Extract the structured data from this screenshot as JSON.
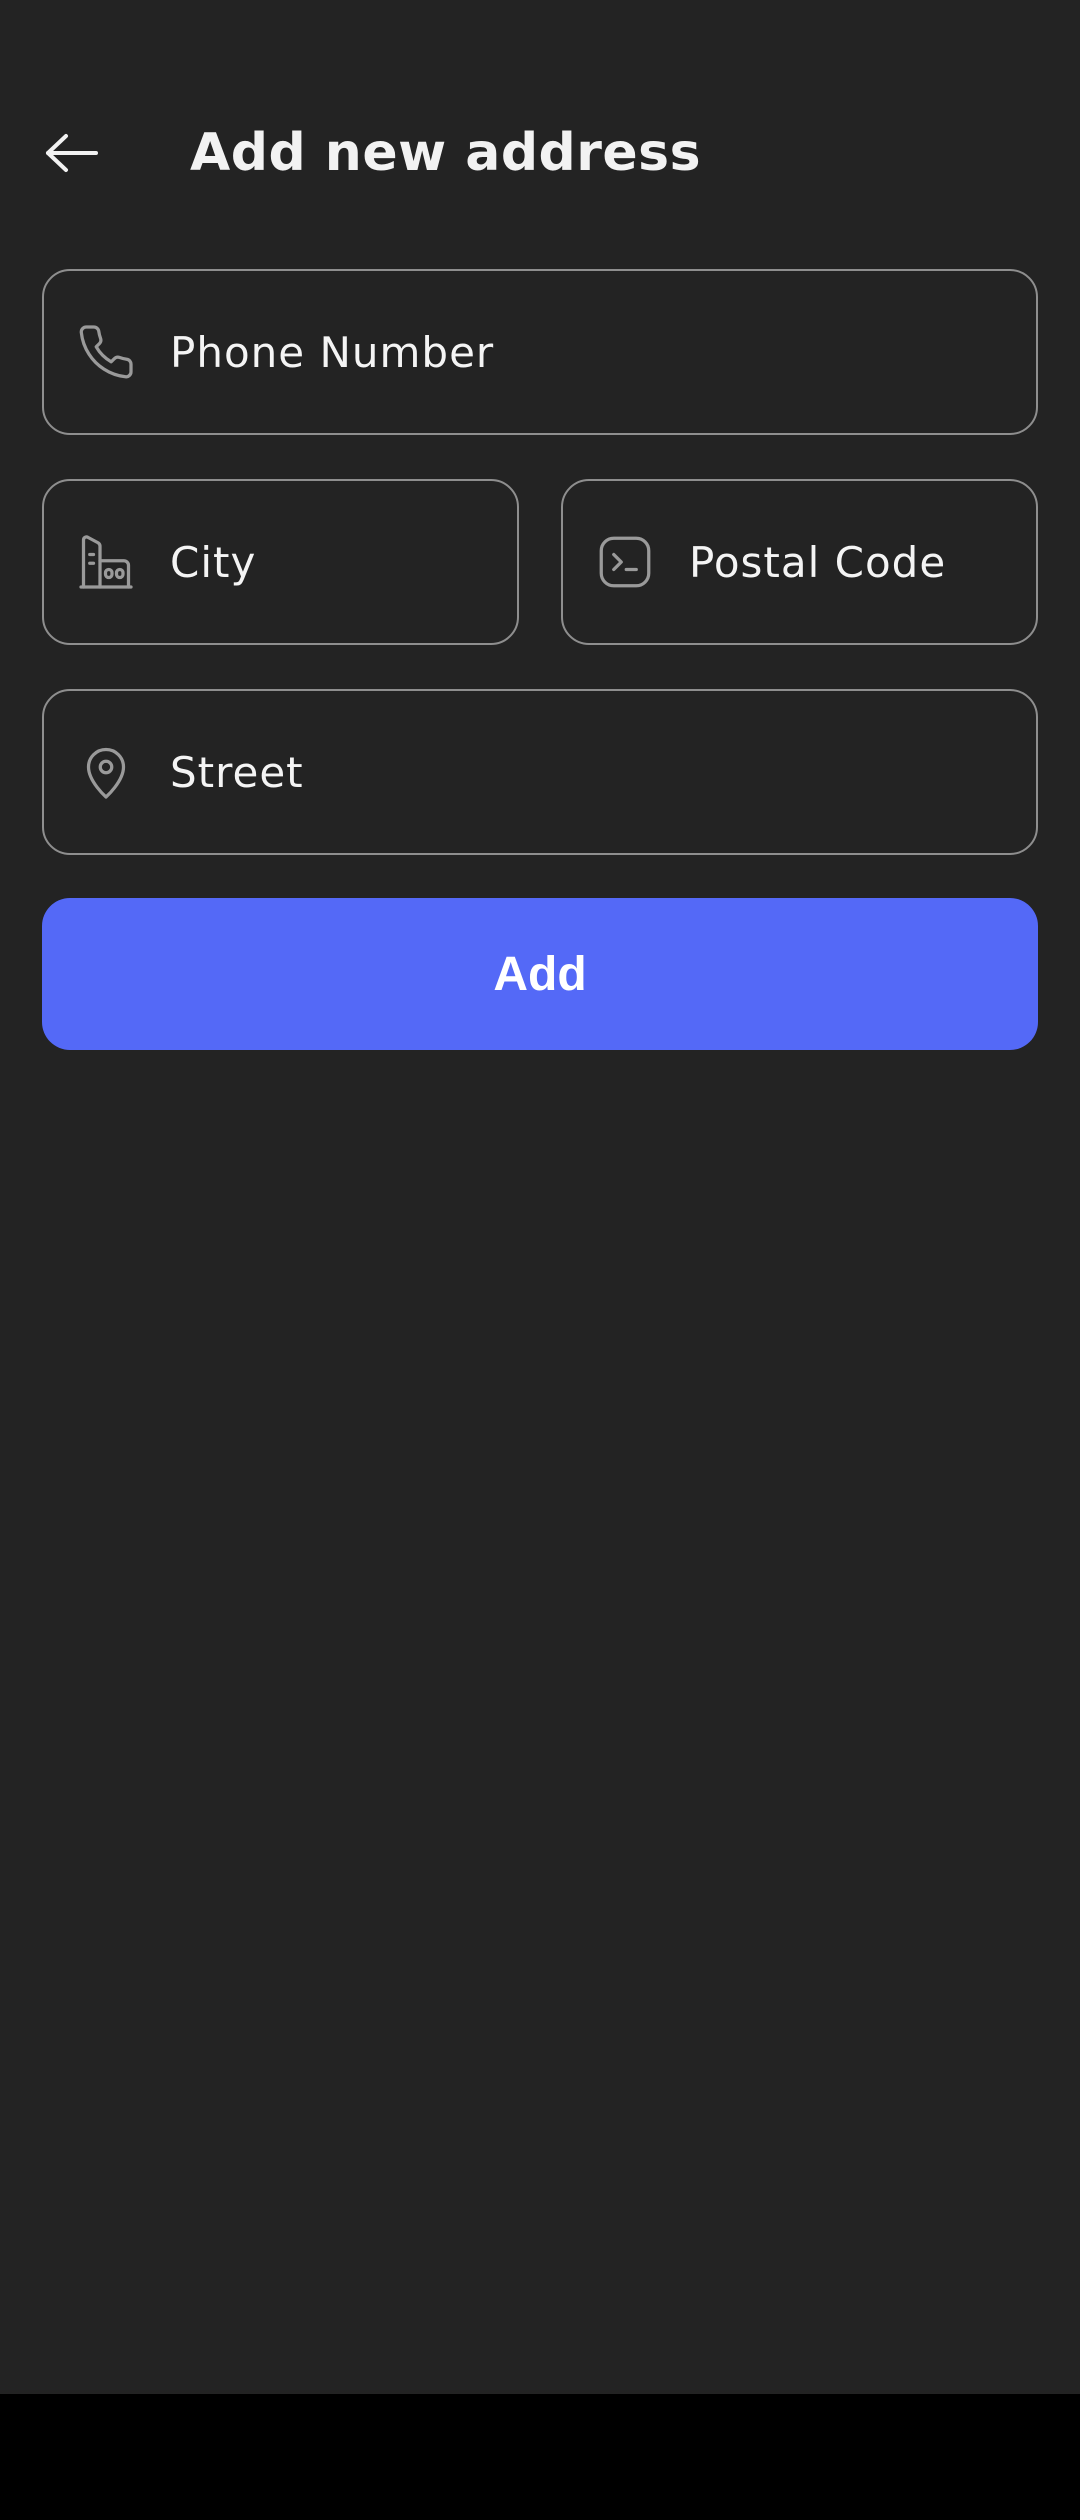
{
  "header": {
    "title": "Add new address",
    "back_icon": "arrow-left-icon"
  },
  "form": {
    "phone": {
      "placeholder": "Phone Number",
      "icon": "phone-icon",
      "value": ""
    },
    "city": {
      "placeholder": "City",
      "icon": "buildings-icon",
      "value": ""
    },
    "postal_code": {
      "placeholder": "Postal Code",
      "icon": "terminal-box-icon",
      "value": ""
    },
    "street": {
      "placeholder": "Street",
      "icon": "map-pin-icon",
      "value": ""
    }
  },
  "actions": {
    "add_label": "Add"
  },
  "colors": {
    "background": "#232323",
    "accent": "#5469f7",
    "field_border": "#8e8e8e",
    "text": "#ffffff",
    "icon": "#9a9a9a",
    "navigation_bar": "#000000"
  }
}
